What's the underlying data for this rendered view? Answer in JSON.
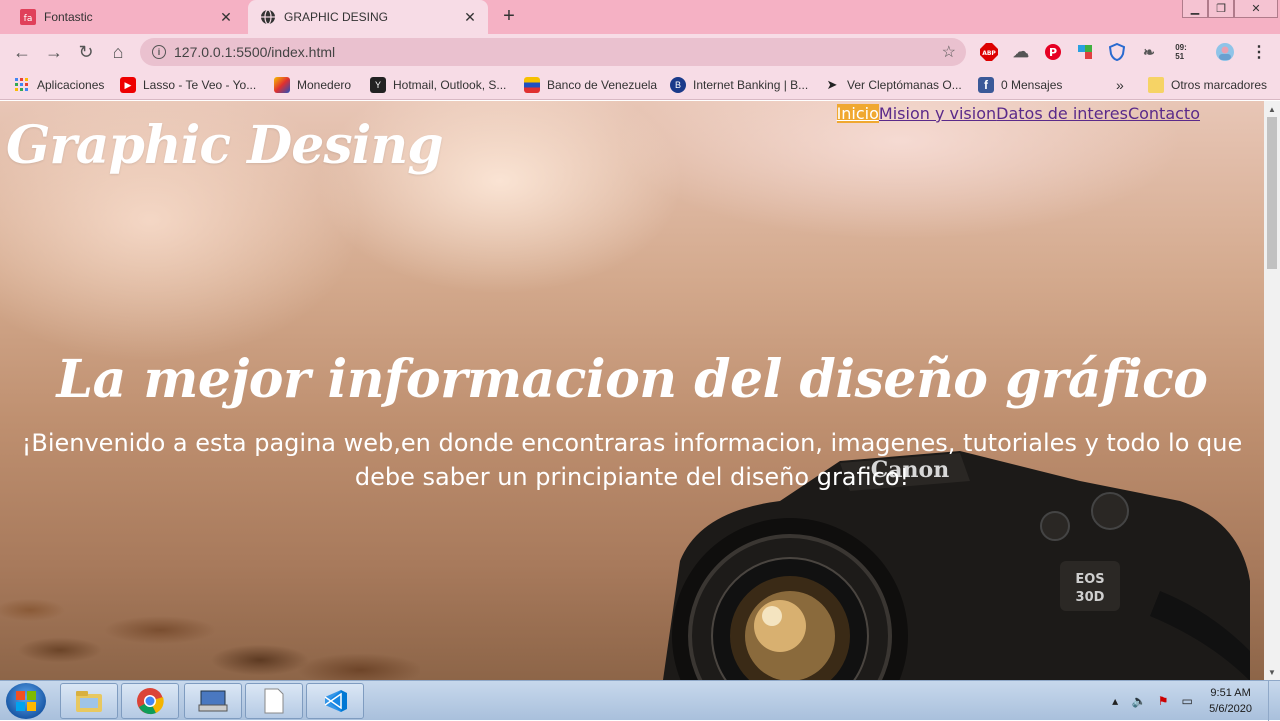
{
  "browser": {
    "tabs": [
      {
        "title": "Fontastic",
        "favicon": "fontastic-icon",
        "active": false
      },
      {
        "title": "GRAPHIC DESING",
        "favicon": "globe-icon",
        "active": true
      }
    ],
    "address": "127.0.0.1:5500/index.html",
    "clock_small": "09:\n51",
    "bookmarks": [
      {
        "label": "Aplicaciones",
        "icon": "apps-grid-icon"
      },
      {
        "label": "Lasso - Te Veo - Yo...",
        "icon": "youtube-icon"
      },
      {
        "label": "Monedero",
        "icon": "monedero-icon"
      },
      {
        "label": "Hotmail, Outlook, S...",
        "icon": "hotmail-icon"
      },
      {
        "label": "Banco de Venezuela",
        "icon": "bank-icon"
      },
      {
        "label": "Internet Banking | B...",
        "icon": "banking-icon"
      },
      {
        "label": "Ver Cleptómanas O...",
        "icon": "movie-icon"
      },
      {
        "label": "0 Mensajes",
        "icon": "facebook-icon"
      }
    ],
    "other_bookmarks": "Otros marcadores",
    "accent": "#f5b1c4"
  },
  "page": {
    "brand": "Graphic Desing",
    "nav": [
      {
        "label": "Inicio",
        "active": true
      },
      {
        "label": "Mision y vision",
        "active": false
      },
      {
        "label": "Datos de interes",
        "active": false
      },
      {
        "label": "Contacto",
        "active": false
      }
    ],
    "hero_title": "La mejor informacion del diseño gráfico",
    "hero_subtitle": "¡Bienvenido a esta pagina web,en donde encontraras informacion, imagenes, tutoriales y todo lo que debe saber un principiante del diseño grafico!",
    "camera_brand": "Canon",
    "camera_model": "EOS\n30D",
    "nav_active_color": "#f0a830",
    "nav_link_color": "#5a2a8a"
  },
  "taskbar": {
    "time": "9:51 AM",
    "date": "5/6/2020"
  }
}
